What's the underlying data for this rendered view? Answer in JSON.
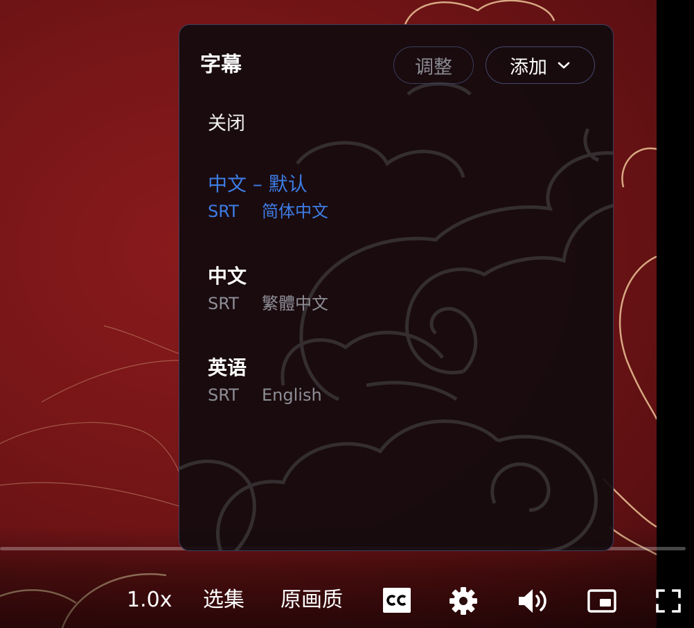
{
  "subtitle_panel": {
    "title": "字幕",
    "adjust_label": "调整",
    "add_label": "添加",
    "options": [
      {
        "id": "off",
        "name": "关闭",
        "selected": false
      },
      {
        "id": "zh-default",
        "name": "中文 – 默认",
        "format": "SRT",
        "language": "简体中文",
        "selected": true
      },
      {
        "id": "zh-trad",
        "name": "中文",
        "format": "SRT",
        "language": "繁體中文",
        "selected": false
      },
      {
        "id": "en",
        "name": "英语",
        "format": "SRT",
        "language": "English",
        "selected": false
      }
    ]
  },
  "controls": {
    "speed_label": "1.0x",
    "episodes_label": "选集",
    "quality_label": "原画质",
    "cc_icon": "cc-icon",
    "settings_icon": "gear-icon",
    "volume_icon": "volume-icon",
    "pip_icon": "picture-in-picture-icon",
    "fullscreen_icon": "fullscreen-icon"
  },
  "progress": {
    "played_fraction": 0.0
  },
  "colors": {
    "selected_accent": "#3d7de6",
    "panel_border": "#3c3f60",
    "video_background": "#741517",
    "decor_gold": "#e0b98f"
  }
}
